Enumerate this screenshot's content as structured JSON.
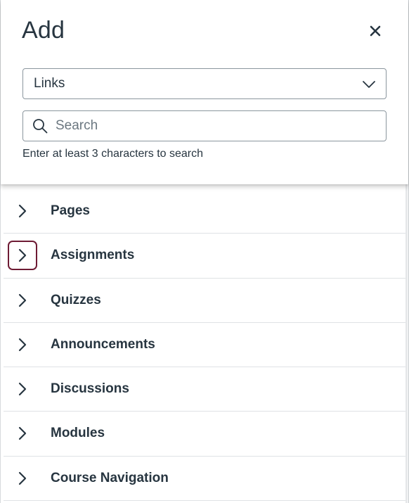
{
  "header": {
    "title": "Add",
    "close_icon": "close-icon"
  },
  "content_type_select": {
    "value": "Links",
    "icon": "chevron-down-icon"
  },
  "search": {
    "placeholder": "Search",
    "value": "",
    "icon": "search-icon",
    "hint": "Enter at least 3 characters to search"
  },
  "groups": [
    {
      "label": "Pages",
      "icon": "chevron-right-icon"
    },
    {
      "label": "Assignments",
      "icon": "chevron-right-icon",
      "focused": true
    },
    {
      "label": "Quizzes",
      "icon": "chevron-right-icon"
    },
    {
      "label": "Announcements",
      "icon": "chevron-right-icon"
    },
    {
      "label": "Discussions",
      "icon": "chevron-right-icon"
    },
    {
      "label": "Modules",
      "icon": "chevron-right-icon"
    },
    {
      "label": "Course Navigation",
      "icon": "chevron-right-icon"
    }
  ],
  "colors": {
    "text": "#273540",
    "focus_ring": "#6e1b34",
    "border": "#8b969e",
    "divider": "#dfe2e5"
  }
}
